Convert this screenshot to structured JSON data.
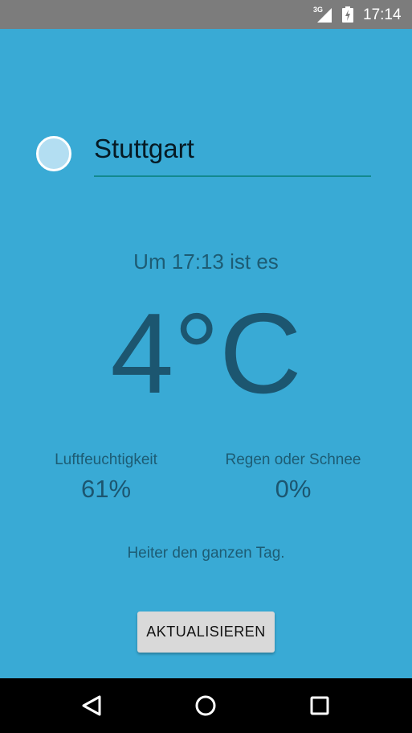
{
  "status_bar": {
    "network": "3G",
    "time": "17:14",
    "icons": [
      "signal-icon",
      "battery-charging-icon"
    ]
  },
  "location": {
    "city_value": "Stuttgart",
    "indicator_icon": "circle-indicator-icon"
  },
  "weather": {
    "time_text": "Um 17:13 ist es",
    "temperature": "4°C",
    "humidity_label": "Luftfeuchtigkeit",
    "humidity_value": "61%",
    "precip_label": "Regen oder Schnee",
    "precip_value": "0%",
    "summary": "Heiter den ganzen Tag."
  },
  "actions": {
    "refresh_label": "AKTUALISIEREN"
  },
  "nav_bar": {
    "icons": [
      "back-icon",
      "home-icon",
      "recent-apps-icon"
    ]
  },
  "colors": {
    "background": "#39aad5",
    "status_bar": "#7c7c7c",
    "text_dark": "#1c5670",
    "input_underline": "#128a8f",
    "button": "#d9d9d9",
    "nav_bar": "#000000"
  }
}
